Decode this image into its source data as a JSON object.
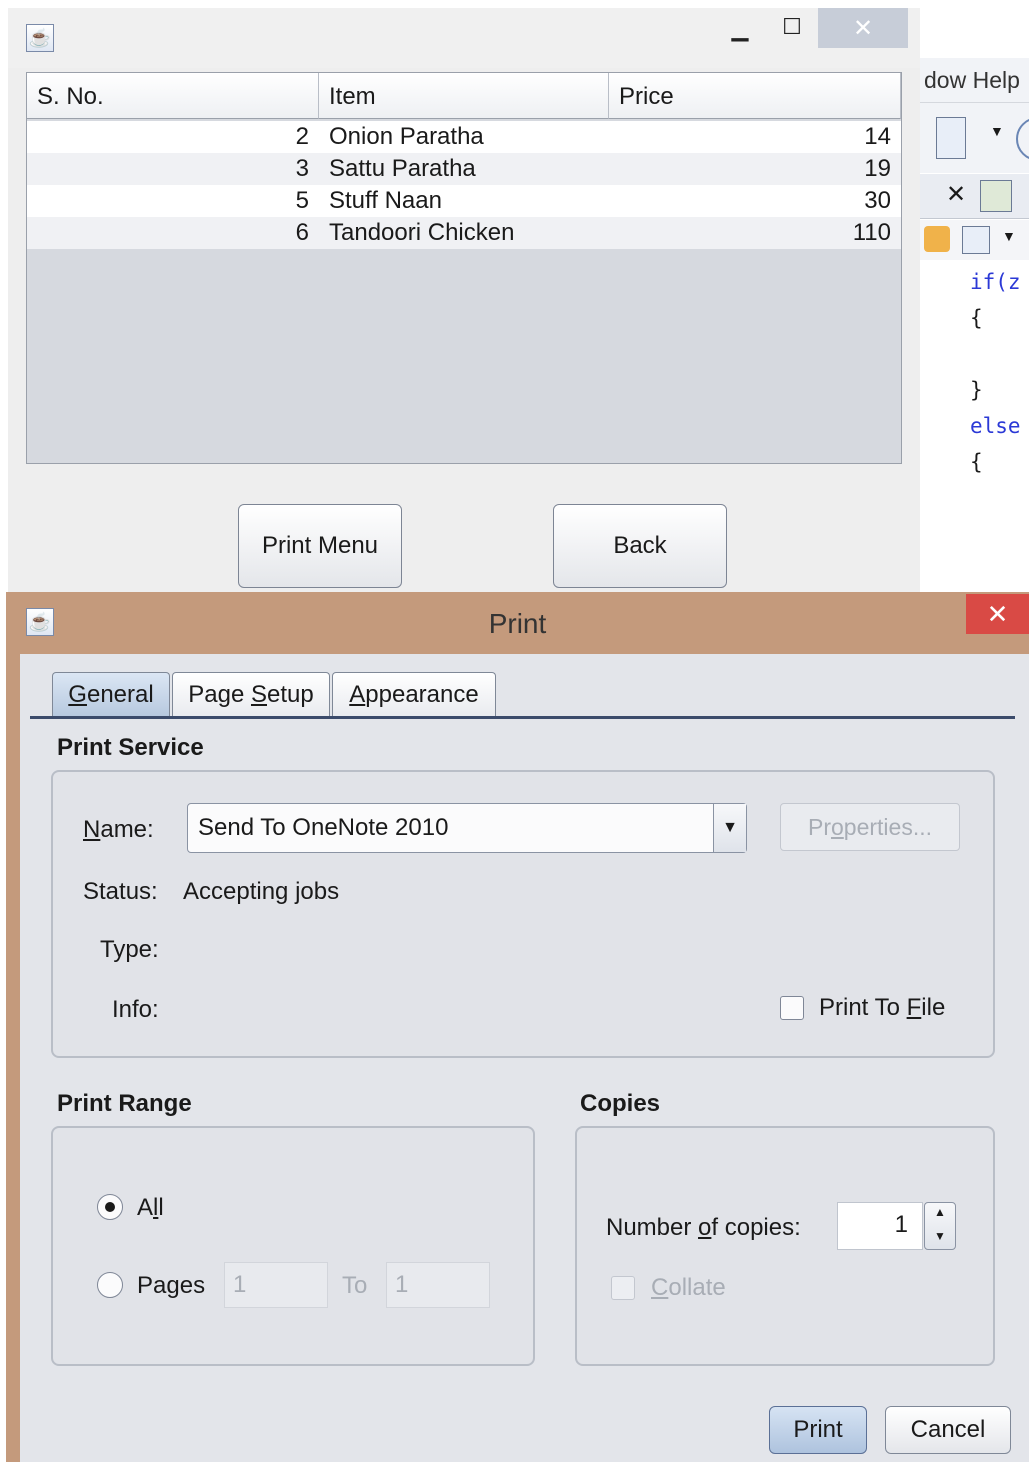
{
  "table_window": {
    "columns": [
      "S. No.",
      "Item",
      "Price"
    ],
    "rows": [
      {
        "sno": "2",
        "item": "Onion Paratha",
        "price": "14"
      },
      {
        "sno": "3",
        "item": "Sattu Paratha",
        "price": "19"
      },
      {
        "sno": "5",
        "item": "Stuff Naan",
        "price": "30"
      },
      {
        "sno": "6",
        "item": "Tandoori Chicken",
        "price": "110"
      }
    ],
    "print_menu_label": "Print Menu",
    "back_label": "Back",
    "close_glyph": "✕"
  },
  "ide": {
    "menu_text": "dow  Help",
    "code_lines": [
      "if(z",
      "{",
      "",
      "}",
      "else",
      "{"
    ]
  },
  "print_dialog": {
    "title": "Print",
    "close_glyph": "✕",
    "tabs": [
      {
        "pre": "",
        "key": "G",
        "post": "eneral"
      },
      {
        "pre": "Page ",
        "key": "S",
        "post": "etup"
      },
      {
        "pre": "",
        "key": "A",
        "post": "ppearance"
      }
    ],
    "print_service": {
      "section": "Print Service",
      "name_label": {
        "key": "N",
        "post": "ame:"
      },
      "name_value": "Send To OneNote 2010",
      "properties": {
        "pre": "Pr",
        "key": "o",
        "post": "perties..."
      },
      "status_label": "Status:",
      "status_value": "Accepting jobs",
      "type_label": "Type:",
      "info_label": "Info:",
      "print_to_file": {
        "pre": "Print To ",
        "key": "F",
        "post": "ile"
      }
    },
    "print_range": {
      "section": "Print Range",
      "all": {
        "pre": "A",
        "key": "l",
        "post": "l"
      },
      "pages": {
        "pre": "Pa",
        "key": "g",
        "post": "es"
      },
      "from": "1",
      "to_label": "To",
      "to": "1"
    },
    "copies": {
      "section": "Copies",
      "number_label": {
        "pre": "Number ",
        "key": "o",
        "post": "f copies:"
      },
      "number_value": "1",
      "collate": {
        "pre": "",
        "key": "C",
        "post": "ollate"
      }
    },
    "print_label": "Print",
    "cancel_label": "Cancel"
  }
}
